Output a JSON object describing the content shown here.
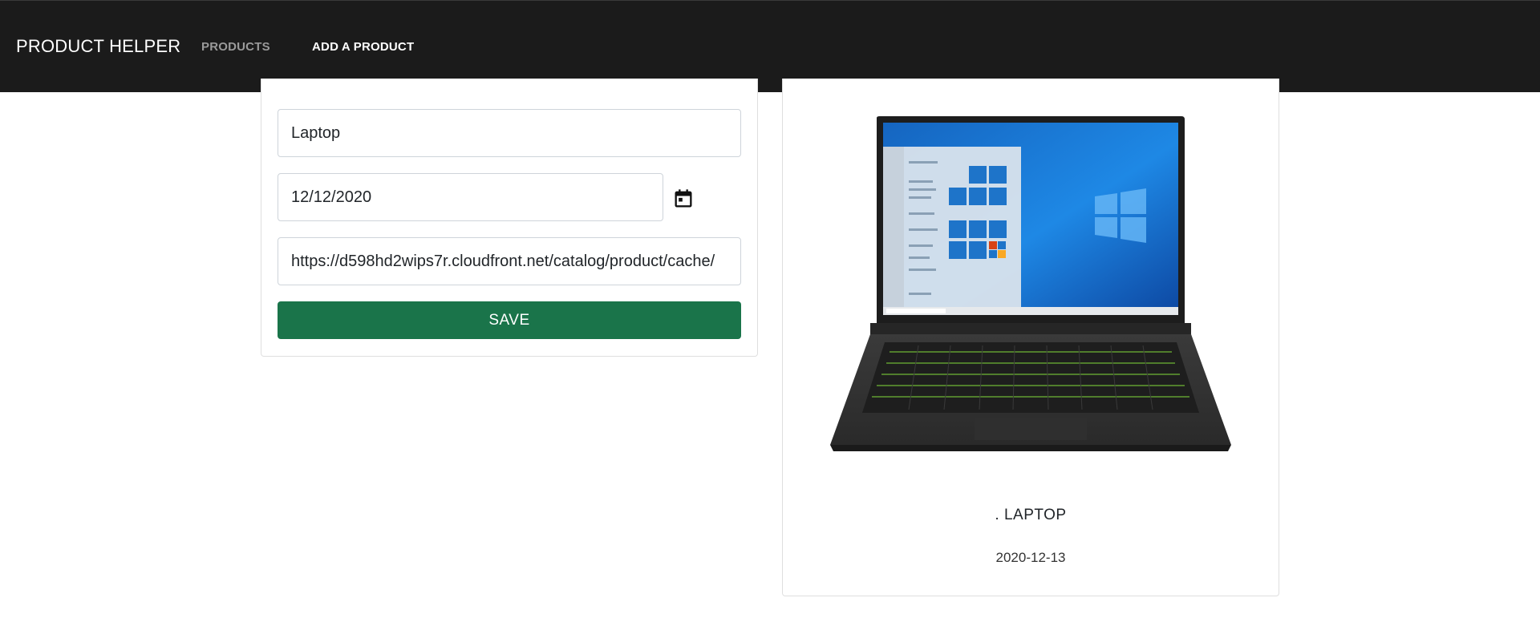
{
  "navbar": {
    "brand": "PRODUCT HELPER",
    "links": [
      {
        "label": "PRODUCTS"
      },
      {
        "label": "ADD A PRODUCT"
      }
    ]
  },
  "form": {
    "name_value": "Laptop",
    "date_value": "12/12/2020",
    "image_url_value": "https://d598hd2wips7r.cloudfront.net/catalog/product/cache/",
    "calendar_icon": "calendar-icon",
    "save_label": "SAVE"
  },
  "product_card": {
    "image": "laptop-image",
    "name": ". LAPTOP",
    "date": "2020-12-13"
  },
  "colors": {
    "navbar_bg": "#1b1b1b",
    "save_button": "#1a744a",
    "nav_inactive": "#9a9a9a",
    "nav_active": "#ffffff"
  }
}
